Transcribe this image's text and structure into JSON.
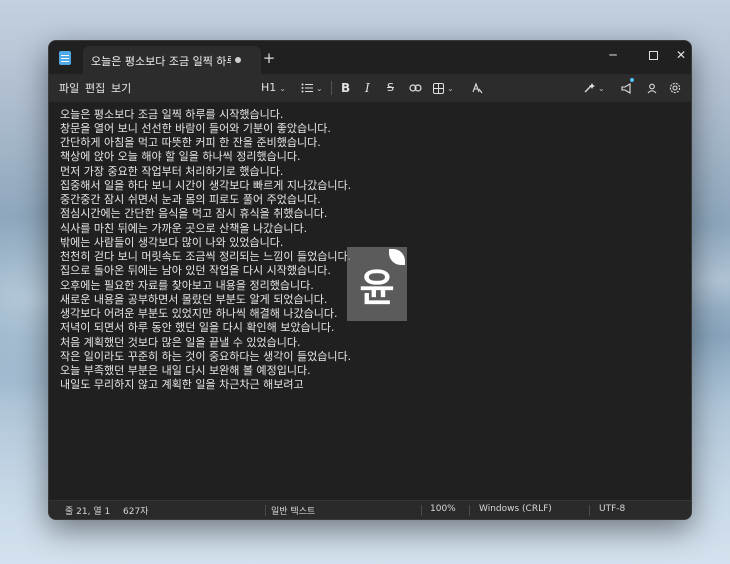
{
  "window": {
    "tab_title": "오늘은 평소보다 조금 일찍 하루를 시",
    "new_tab_label": "+",
    "minimize_label": "─",
    "close_label": "✕"
  },
  "menu": {
    "file": "파일",
    "edit": "편집",
    "view": "보기"
  },
  "toolbar": {
    "heading": "H1",
    "bold": "B",
    "italic": "I",
    "strikethrough": "S",
    "chevron": "⌄",
    "icons": [
      "list-icon",
      "link-icon",
      "table-icon",
      "clear-format-icon",
      "copilot-icon",
      "notification-icon",
      "account-icon",
      "settings-icon"
    ]
  },
  "editor": {
    "lines": [
      "오늘은 평소보다 조금 일찍 하루를 시작했습니다.",
      "창문을 열어 보니 선선한 바람이 들어와 기분이 좋았습니다.",
      "간단하게 아침을 먹고 따뜻한 커피 한 잔을 준비했습니다.",
      "책상에 앉아 오늘 해야 할 일을 하나씩 정리했습니다.",
      "먼저 가장 중요한 작업부터 처리하기로 했습니다.",
      "집중해서 일을 하다 보니 시간이 생각보다 빠르게 지나갔습니다.",
      "중간중간 잠시 쉬면서 눈과 몸의 피로도 풀어 주었습니다.",
      "점심시간에는 간단한 음식을 먹고 잠시 휴식을 취했습니다.",
      "식사를 마친 뒤에는 가까운 곳으로 산책을 나갔습니다.",
      "밖에는 사람들이 생각보다 많이 나와 있었습니다.",
      "천천히 걷다 보니 머릿속도 조금씩 정리되는 느낌이 들었습니다.",
      "집으로 돌아온 뒤에는 남아 있던 작업을 다시 시작했습니다.",
      "오후에는 필요한 자료를 찾아보고 내용을 정리했습니다.",
      "새로운 내용을 공부하면서 몰랐던 부분도 알게 되었습니다.",
      "생각보다 어려운 부분도 있었지만 하나씩 해결해 나갔습니다.",
      "저녁이 되면서 하루 동안 했던 일을 다시 확인해 보았습니다.",
      "처음 계획했던 것보다 많은 일을 끝낼 수 있었습니다.",
      "작은 일이라도 꾸준히 하는 것이 중요하다는 생각이 들었습니다.",
      "오늘 부족했던 부분은 내일 다시 보완해 볼 예정입니다.",
      "내일도 무리하지 않고 계획한 일을 차근차근 해보려고"
    ],
    "watermark_char": "윤"
  },
  "status": {
    "position": "줄 21, 열 1",
    "char_count": "627자",
    "text_type": "일반 텍스트",
    "zoom": "100%",
    "line_ending": "Windows (CRLF)",
    "encoding": "UTF-8"
  },
  "colors": {
    "window_bg": "#202020",
    "toolbar_bg": "#2c2c2c",
    "text": "#e6e6e6",
    "accent": "#4cc2ff"
  }
}
